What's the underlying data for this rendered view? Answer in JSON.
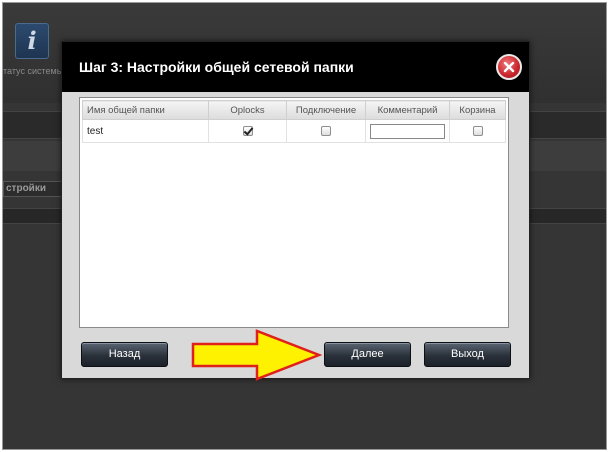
{
  "background": {
    "status_label": "татус системы",
    "status_icon": "info-icon",
    "status_icon_glyph": "i",
    "tab_label": "стройки"
  },
  "dialog": {
    "title": "Шаг 3: Настройки общей сетевой папки",
    "close_icon": "close-icon",
    "table": {
      "columns": [
        "Имя общей папки",
        "Oplocks",
        "Подключение",
        "Комментарий",
        "Корзина"
      ],
      "rows": [
        {
          "name": "test",
          "oplocks": true,
          "connection": false,
          "comment": "",
          "recycle": false
        }
      ]
    },
    "buttons": {
      "back": "Назад",
      "next": "Далее",
      "exit": "Выход"
    }
  },
  "annotation": {
    "arrow_color": "#fff200",
    "arrow_outline": "#e0201b"
  }
}
